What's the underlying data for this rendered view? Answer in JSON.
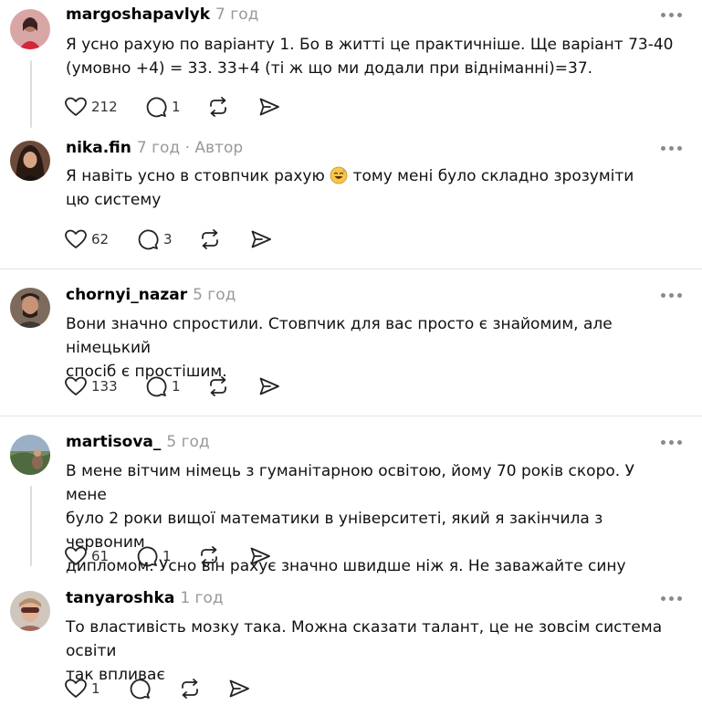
{
  "comments": [
    {
      "username": "margoshapavlyk",
      "time": "7 год",
      "author_tag": "",
      "lines": [
        "Я усно рахую по варіанту 1. Бо в житті це практичніше. Ще варіант 73-40",
        "(умовно +4) = 33. 33+4 (ті ж що ми додали при відніманні)=37."
      ],
      "likes": "212",
      "replies": "1"
    },
    {
      "username": "nika.fin",
      "time": "7 год",
      "author_tag": "· Автор",
      "lines_before_emoji": "Я навіть усно в стовпчик рахую",
      "lines_after_emoji": "тому мені було складно зрозуміти",
      "line2": "цю систему",
      "likes": "62",
      "replies": "3"
    },
    {
      "username": "chornyi_nazar",
      "time": "5 год",
      "author_tag": "",
      "lines": [
        "Вони значно спростили. Стовпчик для вас просто є знайомим, але німецький",
        "спосіб є простішим."
      ],
      "likes": "133",
      "replies": "1"
    },
    {
      "username": "martisova_",
      "time": "5 год",
      "author_tag": "",
      "lines": [
        "В мене вітчим німець з гуманітарною освітою, йому 70 років скоро. У мене",
        "було 2 роки вищої математики в університеті, який я закінчила з червоним",
        "дипломом. Усно він рахує значно швидше ніж я. Не заважайте сину"
      ],
      "likes": "61",
      "replies": "1"
    },
    {
      "username": "tanyaroshka",
      "time": "1 год",
      "author_tag": "",
      "lines": [
        "То властивість мозку така. Можна сказати талант, це не зовсім система освіти",
        "так впливає"
      ],
      "likes": "1",
      "replies": ""
    }
  ],
  "icons": [
    "heart-icon",
    "comment-icon",
    "repost-icon",
    "share-icon",
    "more-icon"
  ]
}
